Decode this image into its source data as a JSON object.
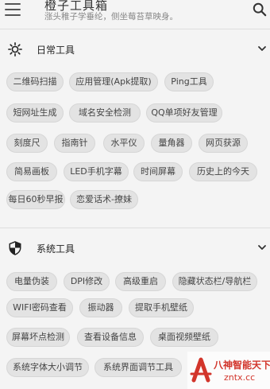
{
  "app": {
    "title": "橙子工具箱",
    "subtitle": "涨头稚子学垂纶，侧坐莓苔草映身。"
  },
  "sections": [
    {
      "title": "日常工具",
      "icon": "sun-icon",
      "items": [
        "二维码扫描",
        "应用管理(Apk提取)",
        "Ping工具",
        "短网址生成",
        "域名安全检测",
        "QQ单项好友管理",
        "刻度尺",
        "指南针",
        "水平仪",
        "量角器",
        "网页获源",
        "简易画板",
        "LED手机字幕",
        "时间屏幕",
        "历史上的今天",
        "每日60秒早报",
        "恋爱话术-撩妹"
      ]
    },
    {
      "title": "系统工具",
      "icon": "shield-icon",
      "items": [
        "电量伪装",
        "DPI修改",
        "高级重启",
        "隐藏状态栏/导航栏",
        "WIFI密码查看",
        "振动器",
        "提取手机壁纸",
        "屏幕坏点检测",
        "查看设备信息",
        "桌面视频壁纸",
        "系统字体大小调节",
        "系统界面调节工具"
      ]
    }
  ],
  "watermark": {
    "text": "八神智能天下",
    "url": "zntx.cc"
  },
  "colors": {
    "background": "#f4f4f4",
    "chip": "#e3e3e3",
    "watermark": "#d2352b"
  }
}
